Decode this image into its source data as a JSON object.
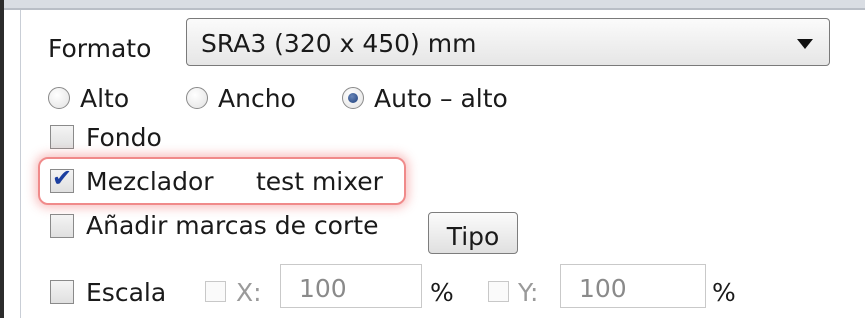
{
  "format": {
    "label": "Formato",
    "selected": "SRA3 (320 x 450) mm"
  },
  "orientation": {
    "options": [
      {
        "label": "Alto",
        "checked": false
      },
      {
        "label": "Ancho",
        "checked": false
      },
      {
        "label": "Auto – alto",
        "checked": true
      }
    ]
  },
  "fondo": {
    "label": "Fondo",
    "checked": false
  },
  "mezclador": {
    "label": "Mezclador",
    "value": "test mixer",
    "checked": true
  },
  "marcas": {
    "label": "Añadir marcas de corte",
    "checked": false
  },
  "tipo_button": {
    "label": "Tipo"
  },
  "escala": {
    "label": "Escala",
    "checked": false,
    "x_label": "X:",
    "x_value": "100",
    "y_label": "Y:",
    "y_value": "100",
    "unit": "%"
  },
  "colors": {
    "highlight": "#f08a8a",
    "check_mark": "#1c3fa0",
    "radio_dot": "#1d3f7c"
  }
}
